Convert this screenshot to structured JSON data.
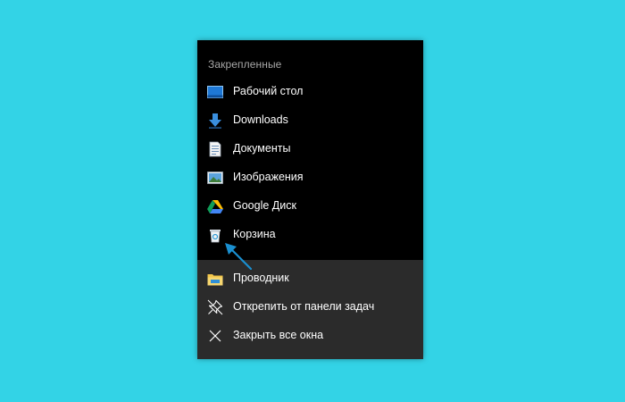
{
  "jumplist": {
    "pinned": {
      "header": "Закрепленные",
      "items": [
        {
          "label": "Рабочий стол",
          "icon": "desktop-icon"
        },
        {
          "label": "Downloads",
          "icon": "download-arrow-icon"
        },
        {
          "label": "Документы",
          "icon": "document-icon"
        },
        {
          "label": "Изображения",
          "icon": "pictures-icon"
        },
        {
          "label": "Google Диск",
          "icon": "google-drive-icon"
        },
        {
          "label": "Корзина",
          "icon": "recycle-bin-icon"
        }
      ]
    },
    "tasks": {
      "items": [
        {
          "label": "Проводник",
          "icon": "file-explorer-icon"
        },
        {
          "label": "Открепить от панели задач",
          "icon": "unpin-icon"
        },
        {
          "label": "Закрыть все окна",
          "icon": "close-icon"
        }
      ]
    }
  },
  "colors": {
    "background": "#33d3e6",
    "menu_dark": "#000000",
    "menu_tasks": "#2b2b2b",
    "text": "#ffffff",
    "header_text": "#a7a7a7",
    "arrow": "#1a8fd0"
  }
}
